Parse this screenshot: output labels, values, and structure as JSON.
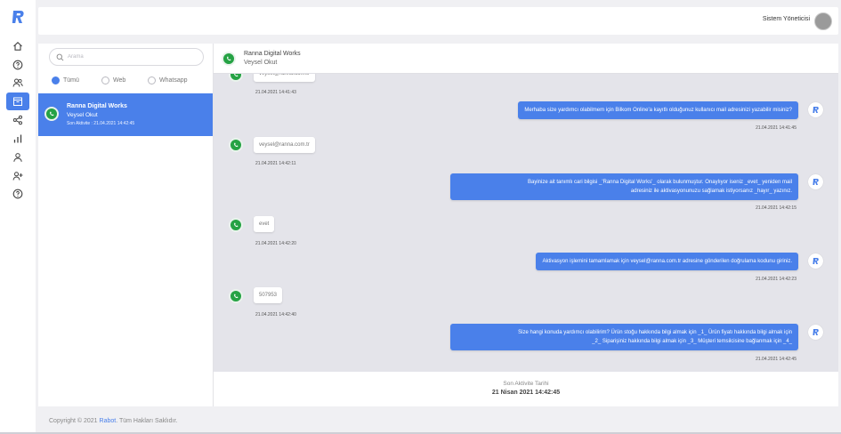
{
  "sidebar": {
    "logo": "R",
    "items": [
      {
        "icon": "home-icon"
      },
      {
        "icon": "help-icon"
      },
      {
        "icon": "users-icon"
      },
      {
        "icon": "inbox-icon",
        "active": true
      },
      {
        "icon": "share-icon"
      },
      {
        "icon": "chart-icon"
      },
      {
        "icon": "user-icon"
      },
      {
        "icon": "user-add-icon"
      },
      {
        "icon": "question-icon"
      }
    ]
  },
  "header": {
    "user_name": "Sistem Yöneticisi"
  },
  "contacts": {
    "search_placeholder": "Arama",
    "filters": [
      {
        "label": "Tümü",
        "checked": true
      },
      {
        "label": "Web",
        "checked": false
      },
      {
        "label": "Whatsapp",
        "checked": false
      }
    ],
    "selected": {
      "name": "Ranna Digital Works",
      "person": "Veysel Okut",
      "last_activity": "Son Aktivite : 21.04.2021 14:42:45"
    }
  },
  "chat": {
    "header_name": "Ranna Digital Works",
    "header_person": "Veysel Okut",
    "messages": [
      {
        "dir": "in",
        "text": "veysel@ranna.com.tr",
        "time": "21.04.2021 14:41:43"
      },
      {
        "dir": "out",
        "text": "Merhaba size yardımcı olabilmem için Bilkom Online'a kayıtlı olduğunuz kullanıcı mail adresinizi yazabilir misiniz?",
        "time": "21.04.2021 14:41:45"
      },
      {
        "dir": "in",
        "text": "veysel@ranna.com.tr",
        "time": "21.04.2021 14:42:11"
      },
      {
        "dir": "out",
        "text_line1": "Bayinize ait tanımlı cari bilgisi _'Ranna Digital Works'_ olarak bulunmuştur. Onaylıyor iseniz _evet_ yeniden mail",
        "text_line2": "adresiniz ile aktivasyonunuzu sağlamak istiyorsanız _hayır_ yazınız.",
        "time": "21.04.2021 14:42:15"
      },
      {
        "dir": "in",
        "text": "evet",
        "time": "21.04.2021 14:42:20"
      },
      {
        "dir": "out",
        "text": "Aktivasyon işlemini tamamlamak için veysel@ranna.com.tr adresine gönderilen doğrulama kodunu giriniz.",
        "time": "21.04.2021 14:42:23"
      },
      {
        "dir": "in",
        "text": "507953",
        "time": "21.04.2021 14:42:40"
      },
      {
        "dir": "out",
        "text_line1": "Size hangi konuda yardımcı olabilirim? Ürün stoğu hakkında bilgi almak için _1_ Ürün fiyatı hakkında bilgi almak için",
        "text_line2": "_2_ Siparişiniz hakkında bilgi almak için _3_ Müşteri temsilcisine bağlanmak için _4_",
        "time": "21.04.2021 14:42:45"
      }
    ],
    "footer_label": "Son Aktivite Tarihi",
    "footer_value": "21 Nisan 2021 14:42:45"
  },
  "footer": {
    "prefix": "Copyright © 2021",
    "brand": "Rabot",
    "suffix": ". Tüm Hakları Saklıdır."
  },
  "colors": {
    "accent": "#4a80ea",
    "whatsapp": "#25a244",
    "chat_bg": "#e4e4ea"
  }
}
